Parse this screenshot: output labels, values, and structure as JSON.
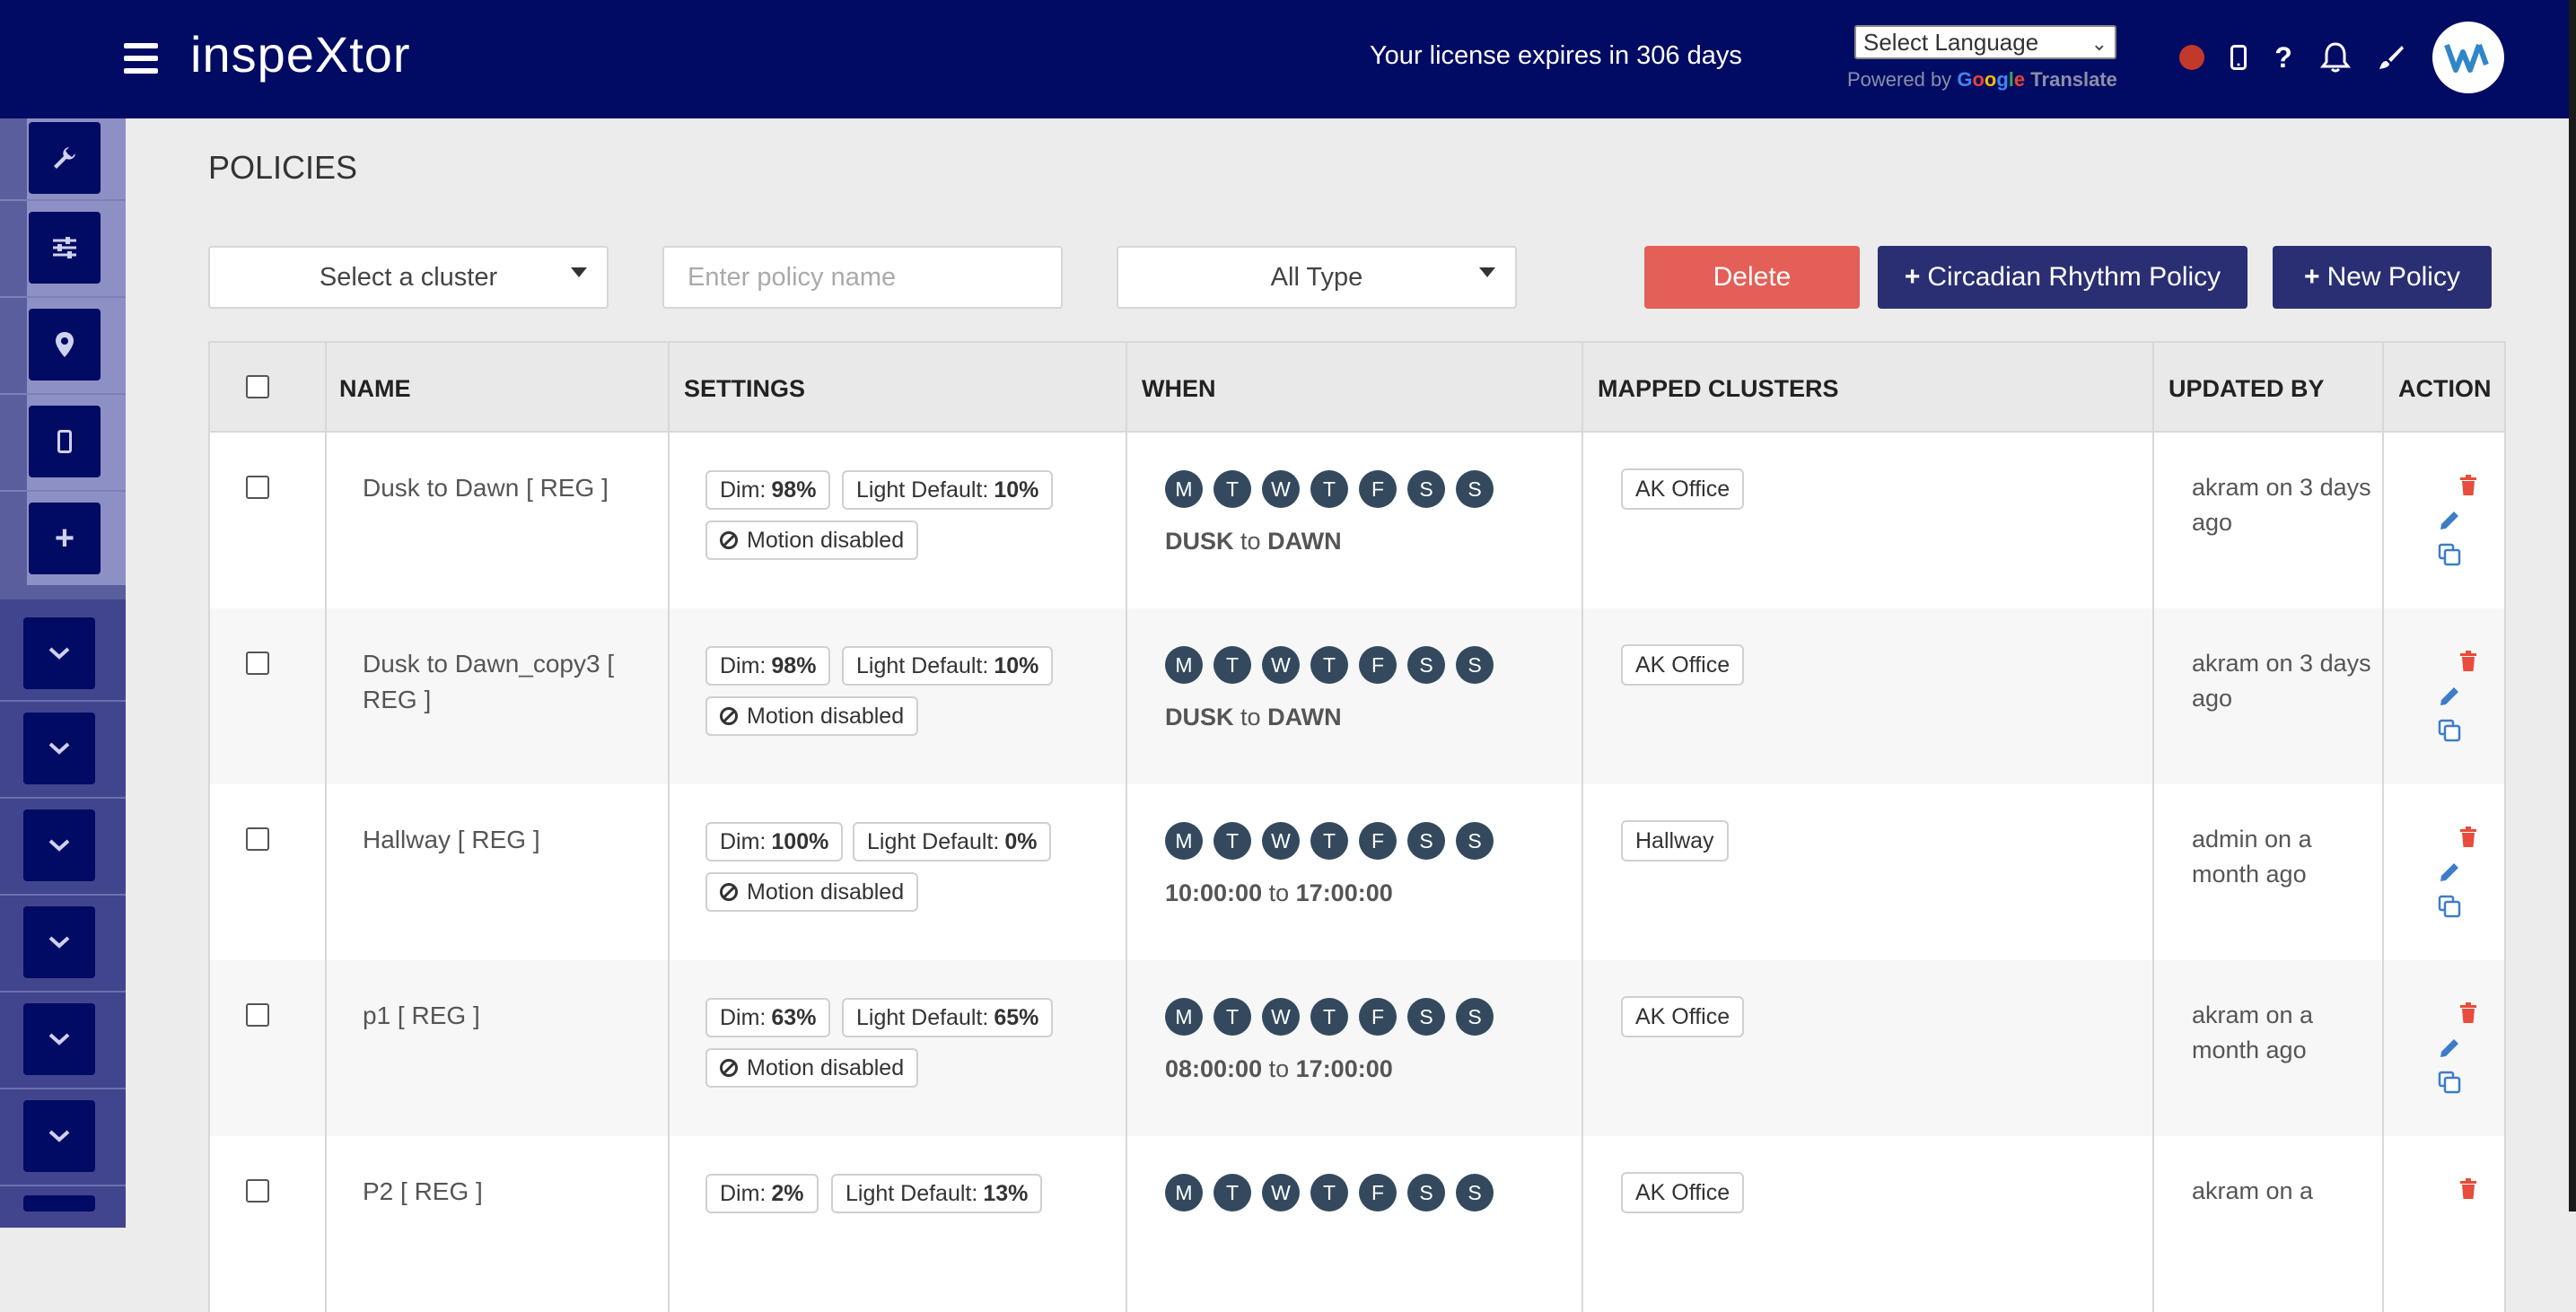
{
  "header": {
    "brand": "inspeXtor",
    "license_text": "Your license expires in 306 days",
    "language_select": "Select Language",
    "powered_by": "Powered by",
    "google": [
      "G",
      "o",
      "o",
      "g",
      "l",
      "e"
    ],
    "translate": "Translate"
  },
  "page": {
    "title": "POLICIES"
  },
  "filters": {
    "cluster_select": "Select a cluster",
    "policy_name_placeholder": "Enter policy name",
    "type_select": "All Type"
  },
  "buttons": {
    "delete": "Delete",
    "circadian": "Circadian Rhythm Policy",
    "new_policy": "New Policy"
  },
  "table": {
    "columns": [
      "NAME",
      "SETTINGS",
      "WHEN",
      "MAPPED CLUSTERS",
      "UPDATED BY",
      "ACTION"
    ],
    "days": [
      "M",
      "T",
      "W",
      "T",
      "F",
      "S",
      "S"
    ],
    "rows": [
      {
        "name": "Dusk to Dawn [ REG ]",
        "dim_label": "Dim:",
        "dim": "98%",
        "light_label": "Light Default:",
        "light": "10%",
        "motion": "Motion disabled",
        "from": "DUSK",
        "to_word": "to",
        "to": "DAWN",
        "cluster": "AK Office",
        "updated": "akram on 3 days ago"
      },
      {
        "name": "Dusk to Dawn_copy3 [ REG ]",
        "dim_label": "Dim:",
        "dim": "98%",
        "light_label": "Light Default:",
        "light": "10%",
        "motion": "Motion disabled",
        "from": "DUSK",
        "to_word": "to",
        "to": "DAWN",
        "cluster": "AK Office",
        "updated": "akram on 3 days ago"
      },
      {
        "name": "Hallway [ REG ]",
        "dim_label": "Dim:",
        "dim": "100%",
        "light_label": "Light Default:",
        "light": "0%",
        "motion": "Motion disabled",
        "from": "10:00:00",
        "to_word": "to",
        "to": "17:00:00",
        "cluster": "Hallway",
        "updated": "admin on a month ago"
      },
      {
        "name": "p1 [ REG ]",
        "dim_label": "Dim:",
        "dim": "63%",
        "light_label": "Light Default:",
        "light": "65%",
        "motion": "Motion disabled",
        "from": "08:00:00",
        "to_word": "to",
        "to": "17:00:00",
        "cluster": "AK Office",
        "updated": "akram on a month ago"
      },
      {
        "name": "P2 [ REG ]",
        "dim_label": "Dim:",
        "dim": "2%",
        "light_label": "Light Default:",
        "light": "13%",
        "motion": "",
        "from": "",
        "to_word": "",
        "to": "",
        "cluster": "AK Office",
        "updated": "akram on a"
      }
    ]
  },
  "colors": {
    "header_bg": "#020b63",
    "primary_button": "#2a2f73",
    "delete_button": "#e45f57",
    "day_circle": "#34495e",
    "record_dot": "#c0392b",
    "trash_icon": "#e74c3c",
    "edit_icon": "#3d7cc9"
  },
  "icons": {
    "sidebar": [
      "wrench-icon",
      "sliders-icon",
      "map-pin-icon",
      "mobile-icon",
      "plus-icon"
    ],
    "sidebar_groups": 6,
    "topbar": [
      "record-dot",
      "mobile-icon",
      "help-icon",
      "bell-icon",
      "brush-icon"
    ]
  }
}
